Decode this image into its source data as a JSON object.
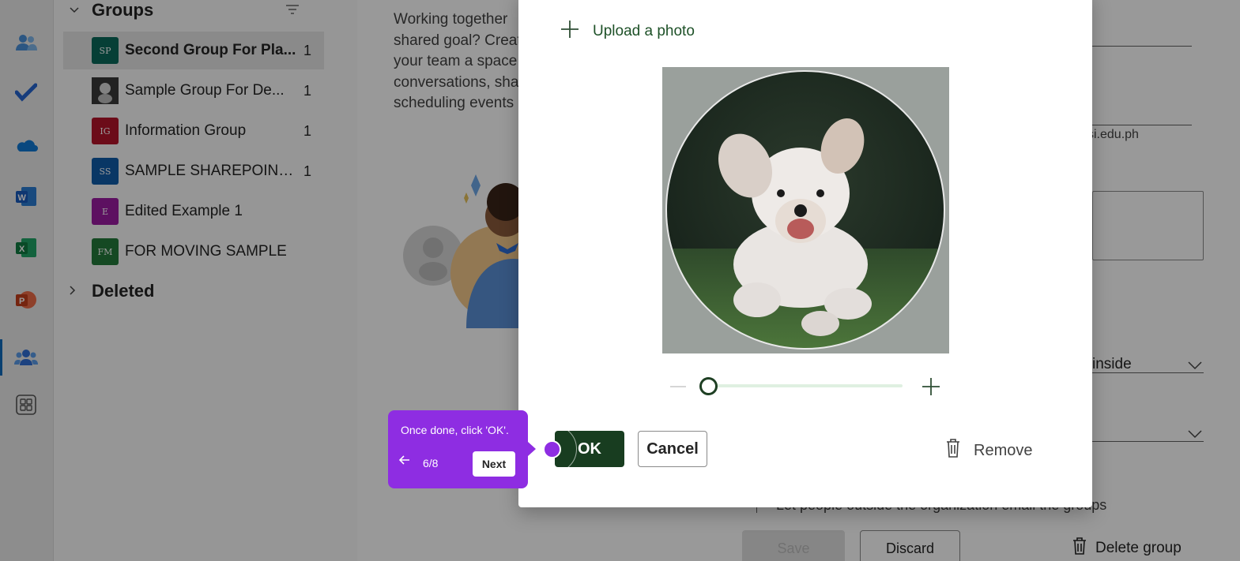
{
  "groups_panel": {
    "title": "Groups",
    "items": [
      {
        "initials": "SP",
        "name": "Second Group For Pla...",
        "count": "1",
        "color": "#0b6a5a"
      },
      {
        "initials": "",
        "name": "Sample Group For De...",
        "count": "1",
        "color": "#2d2d2d"
      },
      {
        "initials": "IG",
        "name": "Information Group",
        "count": "1",
        "color": "#b5152b"
      },
      {
        "initials": "SS",
        "name": "SAMPLE SHAREPOINT ...",
        "count": "1",
        "color": "#0f5ca8"
      },
      {
        "initials": "E",
        "name": "Edited Example 1",
        "count": "",
        "color": "#9b1ba2"
      },
      {
        "initials": "FM",
        "name": "FOR MOVING SAMPLE",
        "count": "",
        "color": "#237a3b"
      }
    ],
    "deleted_label": "Deleted"
  },
  "middle": {
    "lines": [
      "Working together",
      "shared goal? Creat",
      "your team a space",
      "conversations, sha",
      "scheduling events"
    ]
  },
  "right_panel": {
    "email_fragment": "si.edu.ph",
    "dropdown1_value": "inside",
    "checkbox_label": "Let people outside the organization email the groups",
    "save_label": "Save",
    "discard_label": "Discard",
    "delete_label": "Delete group"
  },
  "modal": {
    "upload_label": "Upload a photo",
    "ok_label": "OK",
    "cancel_label": "Cancel",
    "remove_label": "Remove",
    "zoom_level": 0
  },
  "tour": {
    "text": "Once done, click 'OK'.",
    "step": "6/8",
    "next_label": "Next",
    "color": "#8e2de2"
  },
  "colors": {
    "primary_green": "#183d20",
    "accent_purple": "#8e2de2"
  }
}
